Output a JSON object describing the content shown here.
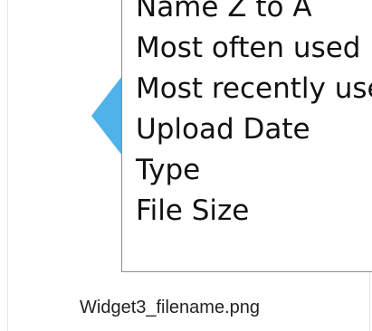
{
  "sort_menu": {
    "items": [
      "Name Z to A",
      "Most often used",
      "Most recently used",
      "Upload Date",
      "Type",
      "File Size"
    ]
  },
  "caption": "Widget3_filename.png",
  "colors": {
    "pointer": "#4fb3ea",
    "border": "#8e8e8e"
  }
}
